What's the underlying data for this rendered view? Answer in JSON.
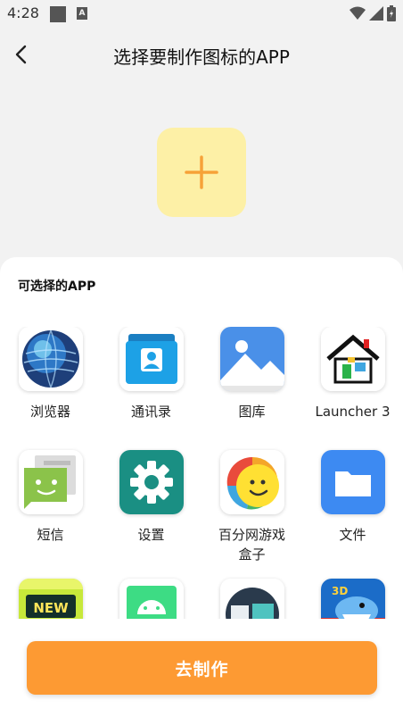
{
  "status": {
    "time": "4:28",
    "a_label": "A"
  },
  "header": {
    "title": "选择要制作图标的APP"
  },
  "sheet": {
    "title": "可选择的APP"
  },
  "apps": [
    {
      "label": "浏览器",
      "icon": "globe-icon"
    },
    {
      "label": "通讯录",
      "icon": "contacts-icon"
    },
    {
      "label": "图库",
      "icon": "gallery-icon"
    },
    {
      "label": "Launcher 3",
      "icon": "launcher-house-icon"
    },
    {
      "label": "短信",
      "icon": "sms-icon"
    },
    {
      "label": "设置",
      "icon": "settings-gear-icon"
    },
    {
      "label": "百分网游戏盒子",
      "icon": "game-box-icon"
    },
    {
      "label": "文件",
      "icon": "folder-icon"
    },
    {
      "label": "",
      "icon": "new-sign-icon"
    },
    {
      "label": "",
      "icon": "android-icon"
    },
    {
      "label": "",
      "icon": "app-icon"
    },
    {
      "label": "",
      "icon": "3d-shark-game-icon"
    }
  ],
  "footer": {
    "button_label": "去制作"
  },
  "colors": {
    "accent": "#fd9a33",
    "add_tile": "#fdf0a6",
    "plus": "#f6a238"
  }
}
